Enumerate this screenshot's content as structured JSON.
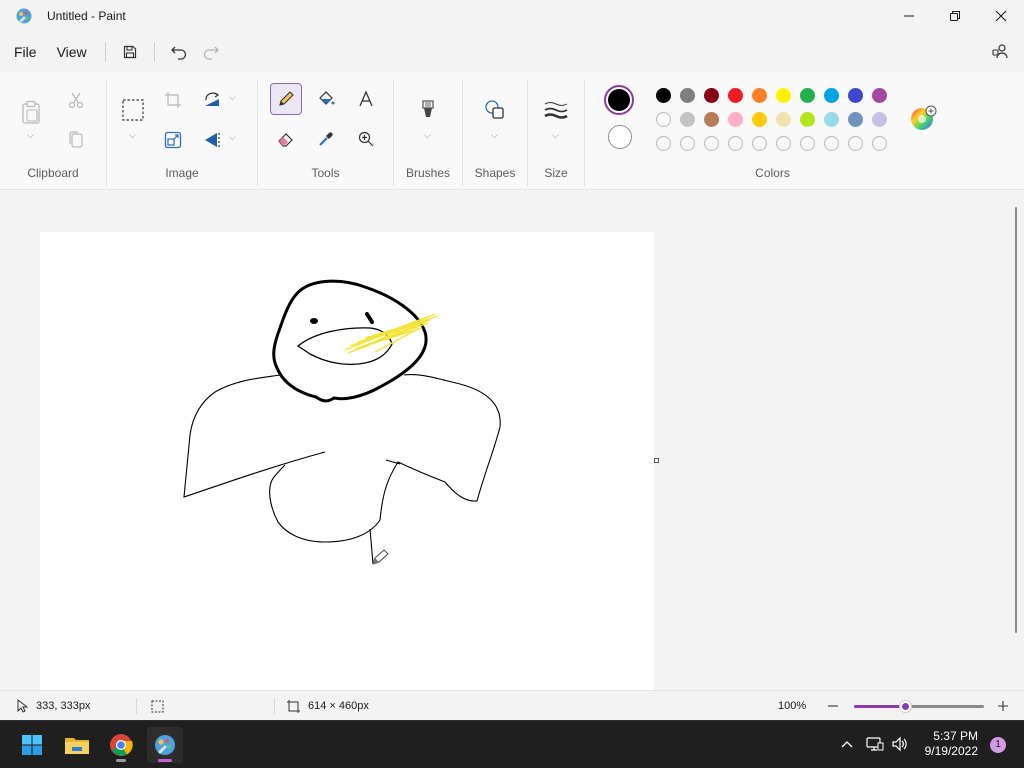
{
  "window": {
    "title": "Untitled - Paint"
  },
  "menu": {
    "file": "File",
    "view": "View"
  },
  "ribbon": {
    "groups": {
      "clipboard": "Clipboard",
      "image": "Image",
      "tools": "Tools",
      "brushes": "Brushes",
      "shapes": "Shapes",
      "size": "Size",
      "colors": "Colors"
    },
    "primary_color": "#000000",
    "secondary_color": "#ffffff",
    "palette_row1": [
      "#000000",
      "#7f7f7f",
      "#880015",
      "#ed1c24",
      "#ff7f27",
      "#fff200",
      "#22b14c",
      "#00a2e8",
      "#3f48cc",
      "#a349a4"
    ],
    "palette_row2": [
      "#ffffff",
      "#c3c3c3",
      "#b97a57",
      "#ffaec9",
      "#ffc90e",
      "#efe4b0",
      "#b5e61d",
      "#99d9ea",
      "#7092be",
      "#c8bfe7"
    ],
    "palette_row3_empty_count": 10
  },
  "status": {
    "cursor_pos": "333, 333px",
    "canvas_size": "614 × 460px",
    "zoom": "100%",
    "zoom_level": 0.4
  },
  "taskbar": {
    "time": "5:37 PM",
    "date": "9/19/2022",
    "notification_count": "1",
    "pinned": [
      "start-icon",
      "file-explorer-icon",
      "chrome-icon",
      "paint-icon"
    ]
  }
}
